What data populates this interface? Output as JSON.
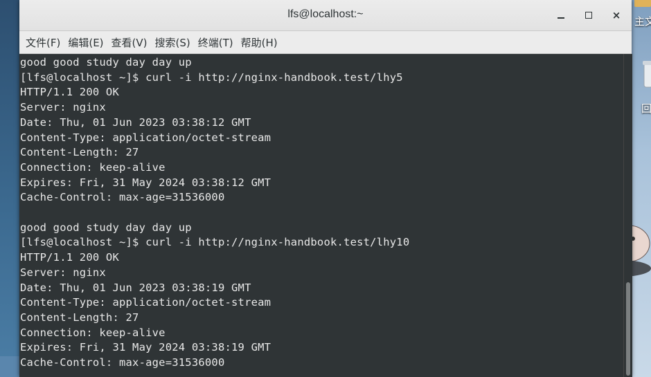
{
  "window": {
    "title": "lfs@localhost:~",
    "minimize_label": "",
    "maximize_label": "",
    "close_label": "×"
  },
  "menu": [
    "文件(F)",
    "编辑(E)",
    "查看(V)",
    "搜索(S)",
    "终端(T)",
    "帮助(H)"
  ],
  "terminal_lines": [
    "good good study day day up",
    "[lfs@localhost ~]$ curl -i http://nginx-handbook.test/lhy5",
    "HTTP/1.1 200 OK",
    "Server: nginx",
    "Date: Thu, 01 Jun 2023 03:38:12 GMT",
    "Content-Type: application/octet-stream",
    "Content-Length: 27",
    "Connection: keep-alive",
    "Expires: Fri, 31 May 2024 03:38:12 GMT",
    "Cache-Control: max-age=31536000",
    "",
    "good good study day day up",
    "[lfs@localhost ~]$ curl -i http://nginx-handbook.test/lhy10",
    "HTTP/1.1 200 OK",
    "Server: nginx",
    "Date: Thu, 01 Jun 2023 03:38:19 GMT",
    "Content-Type: application/octet-stream",
    "Content-Length: 27",
    "Connection: keep-alive",
    "Expires: Fri, 31 May 2024 03:38:19 GMT",
    "Cache-Control: max-age=31536000"
  ],
  "desktop": {
    "home_label": "主文",
    "trash_label": "回"
  },
  "colors": {
    "terminal_bg": "#2f3436",
    "terminal_fg": "#e8e8e8",
    "titlebar": "#e6e6e6"
  },
  "icons": [
    "minimize-icon",
    "maximize-icon",
    "close-icon",
    "folder-icon",
    "trash-icon",
    "mascot-sticker"
  ]
}
